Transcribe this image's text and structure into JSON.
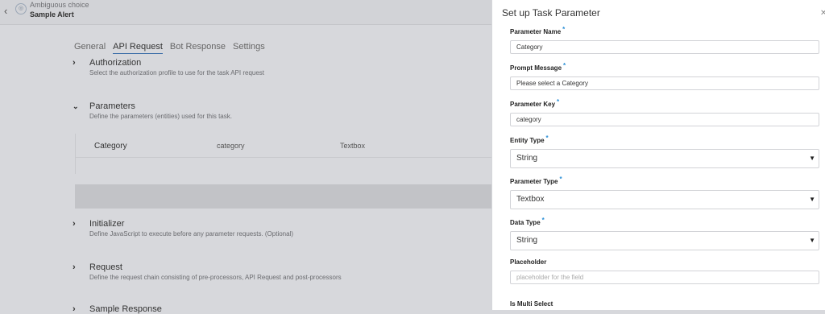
{
  "header": {
    "breadcrumb_parent": "Ambiguous choice",
    "breadcrumb_current": "Sample Alert"
  },
  "tabs": [
    {
      "label": "General"
    },
    {
      "label": "API Request"
    },
    {
      "label": "Bot Response"
    },
    {
      "label": "Settings"
    }
  ],
  "sections": {
    "authorization": {
      "title": "Authorization",
      "desc": "Select the authorization profile to use for the task API request"
    },
    "parameters": {
      "title": "Parameters",
      "desc": "Define the parameters (entities) used for this task."
    },
    "initializer": {
      "title": "Initializer",
      "desc": "Define JavaScript to execute before any parameter requests. (Optional)"
    },
    "request": {
      "title": "Request",
      "desc": "Define the request chain consisting of pre-processors, API Request and post-processors"
    },
    "sample_response": {
      "title": "Sample Response"
    }
  },
  "param_table": {
    "row": {
      "name": "Category",
      "key": "category",
      "type": "Textbox"
    }
  },
  "panel": {
    "title": "Set up Task Parameter",
    "fields": {
      "parameter_name": {
        "label": "Parameter Name",
        "value": "Category"
      },
      "prompt_message": {
        "label": "Prompt Message",
        "value": "Please select a Category"
      },
      "parameter_key": {
        "label": "Parameter Key",
        "value": "category"
      },
      "entity_type": {
        "label": "Entity Type",
        "value": "String"
      },
      "parameter_type": {
        "label": "Parameter Type",
        "value": "Textbox"
      },
      "data_type": {
        "label": "Data Type",
        "value": "String"
      },
      "placeholder": {
        "label": "Placeholder",
        "placeholder": "placeholder for the field"
      },
      "is_multi_select": {
        "label": "Is Multi Select"
      }
    },
    "required_marker": "*"
  },
  "icons": {
    "back": "chevron-left-icon",
    "bot": "bot-avatar-icon",
    "close": "close-icon",
    "expand": "chevron-right-icon",
    "collapse": "chevron-down-icon",
    "dropdown": "caret-down-icon"
  },
  "colors": {
    "accent": "#2b8fd6",
    "active_tab_underline": "#3d6fa8",
    "overlay_bg": "#d7d8dc"
  }
}
